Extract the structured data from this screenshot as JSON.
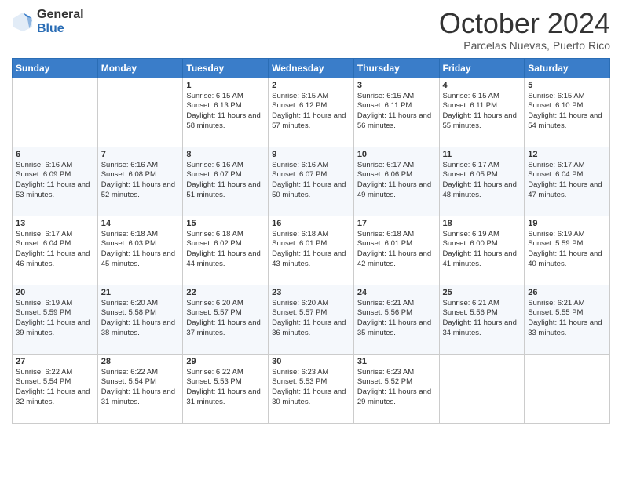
{
  "logo": {
    "general": "General",
    "blue": "Blue"
  },
  "header": {
    "month": "October 2024",
    "location": "Parcelas Nuevas, Puerto Rico"
  },
  "weekdays": [
    "Sunday",
    "Monday",
    "Tuesday",
    "Wednesday",
    "Thursday",
    "Friday",
    "Saturday"
  ],
  "weeks": [
    [
      {
        "day": "",
        "info": ""
      },
      {
        "day": "",
        "info": ""
      },
      {
        "day": "1",
        "info": "Sunrise: 6:15 AM\nSunset: 6:13 PM\nDaylight: 11 hours and 58 minutes."
      },
      {
        "day": "2",
        "info": "Sunrise: 6:15 AM\nSunset: 6:12 PM\nDaylight: 11 hours and 57 minutes."
      },
      {
        "day": "3",
        "info": "Sunrise: 6:15 AM\nSunset: 6:11 PM\nDaylight: 11 hours and 56 minutes."
      },
      {
        "day": "4",
        "info": "Sunrise: 6:15 AM\nSunset: 6:11 PM\nDaylight: 11 hours and 55 minutes."
      },
      {
        "day": "5",
        "info": "Sunrise: 6:15 AM\nSunset: 6:10 PM\nDaylight: 11 hours and 54 minutes."
      }
    ],
    [
      {
        "day": "6",
        "info": "Sunrise: 6:16 AM\nSunset: 6:09 PM\nDaylight: 11 hours and 53 minutes."
      },
      {
        "day": "7",
        "info": "Sunrise: 6:16 AM\nSunset: 6:08 PM\nDaylight: 11 hours and 52 minutes."
      },
      {
        "day": "8",
        "info": "Sunrise: 6:16 AM\nSunset: 6:07 PM\nDaylight: 11 hours and 51 minutes."
      },
      {
        "day": "9",
        "info": "Sunrise: 6:16 AM\nSunset: 6:07 PM\nDaylight: 11 hours and 50 minutes."
      },
      {
        "day": "10",
        "info": "Sunrise: 6:17 AM\nSunset: 6:06 PM\nDaylight: 11 hours and 49 minutes."
      },
      {
        "day": "11",
        "info": "Sunrise: 6:17 AM\nSunset: 6:05 PM\nDaylight: 11 hours and 48 minutes."
      },
      {
        "day": "12",
        "info": "Sunrise: 6:17 AM\nSunset: 6:04 PM\nDaylight: 11 hours and 47 minutes."
      }
    ],
    [
      {
        "day": "13",
        "info": "Sunrise: 6:17 AM\nSunset: 6:04 PM\nDaylight: 11 hours and 46 minutes."
      },
      {
        "day": "14",
        "info": "Sunrise: 6:18 AM\nSunset: 6:03 PM\nDaylight: 11 hours and 45 minutes."
      },
      {
        "day": "15",
        "info": "Sunrise: 6:18 AM\nSunset: 6:02 PM\nDaylight: 11 hours and 44 minutes."
      },
      {
        "day": "16",
        "info": "Sunrise: 6:18 AM\nSunset: 6:01 PM\nDaylight: 11 hours and 43 minutes."
      },
      {
        "day": "17",
        "info": "Sunrise: 6:18 AM\nSunset: 6:01 PM\nDaylight: 11 hours and 42 minutes."
      },
      {
        "day": "18",
        "info": "Sunrise: 6:19 AM\nSunset: 6:00 PM\nDaylight: 11 hours and 41 minutes."
      },
      {
        "day": "19",
        "info": "Sunrise: 6:19 AM\nSunset: 5:59 PM\nDaylight: 11 hours and 40 minutes."
      }
    ],
    [
      {
        "day": "20",
        "info": "Sunrise: 6:19 AM\nSunset: 5:59 PM\nDaylight: 11 hours and 39 minutes."
      },
      {
        "day": "21",
        "info": "Sunrise: 6:20 AM\nSunset: 5:58 PM\nDaylight: 11 hours and 38 minutes."
      },
      {
        "day": "22",
        "info": "Sunrise: 6:20 AM\nSunset: 5:57 PM\nDaylight: 11 hours and 37 minutes."
      },
      {
        "day": "23",
        "info": "Sunrise: 6:20 AM\nSunset: 5:57 PM\nDaylight: 11 hours and 36 minutes."
      },
      {
        "day": "24",
        "info": "Sunrise: 6:21 AM\nSunset: 5:56 PM\nDaylight: 11 hours and 35 minutes."
      },
      {
        "day": "25",
        "info": "Sunrise: 6:21 AM\nSunset: 5:56 PM\nDaylight: 11 hours and 34 minutes."
      },
      {
        "day": "26",
        "info": "Sunrise: 6:21 AM\nSunset: 5:55 PM\nDaylight: 11 hours and 33 minutes."
      }
    ],
    [
      {
        "day": "27",
        "info": "Sunrise: 6:22 AM\nSunset: 5:54 PM\nDaylight: 11 hours and 32 minutes."
      },
      {
        "day": "28",
        "info": "Sunrise: 6:22 AM\nSunset: 5:54 PM\nDaylight: 11 hours and 31 minutes."
      },
      {
        "day": "29",
        "info": "Sunrise: 6:22 AM\nSunset: 5:53 PM\nDaylight: 11 hours and 31 minutes."
      },
      {
        "day": "30",
        "info": "Sunrise: 6:23 AM\nSunset: 5:53 PM\nDaylight: 11 hours and 30 minutes."
      },
      {
        "day": "31",
        "info": "Sunrise: 6:23 AM\nSunset: 5:52 PM\nDaylight: 11 hours and 29 minutes."
      },
      {
        "day": "",
        "info": ""
      },
      {
        "day": "",
        "info": ""
      }
    ]
  ]
}
